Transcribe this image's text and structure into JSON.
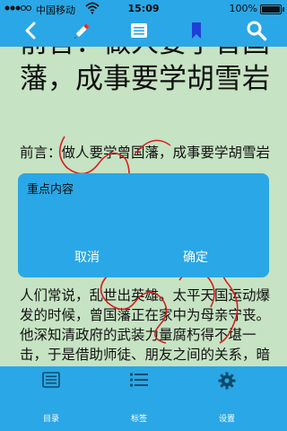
{
  "status_bar": {
    "carrier": "中国移动",
    "time": "15:09",
    "battery": "100%",
    "battery_level": 1.0
  },
  "toolbar": {
    "icons": [
      "back-chevron-icon",
      "pen-icon",
      "notes-list-icon",
      "bookmark-icon",
      "search-icon"
    ]
  },
  "content": {
    "title": "前言：做人要学曾国藩，成事要学胡雪岩",
    "paragraph1": "前言：做人要学曾国藩，成事要学胡雪岩",
    "paragraph2": "人们常说，乱世出英雄。太平天国运动爆发的时候，曾国藩正在家中为母亲守丧。他深知清政府的武装力量腐朽得不堪一击，于是借助师徒、朋友之间的关系，暗自操练出一支配备精良、战斗力极强的队伍"
  },
  "dialog": {
    "title": "重点内容",
    "cancel_label": "取消",
    "confirm_label": "确定"
  },
  "tabbar": {
    "items": [
      {
        "label": "目录",
        "icon": "catalog-icon"
      },
      {
        "label": "标签",
        "icon": "tags-icon"
      },
      {
        "label": "设置",
        "icon": "settings-gear-icon"
      }
    ]
  },
  "colors": {
    "bar_blue": "#2aa7e6",
    "page_background": "#c6e3c3",
    "scribble_red": "#d42020"
  }
}
